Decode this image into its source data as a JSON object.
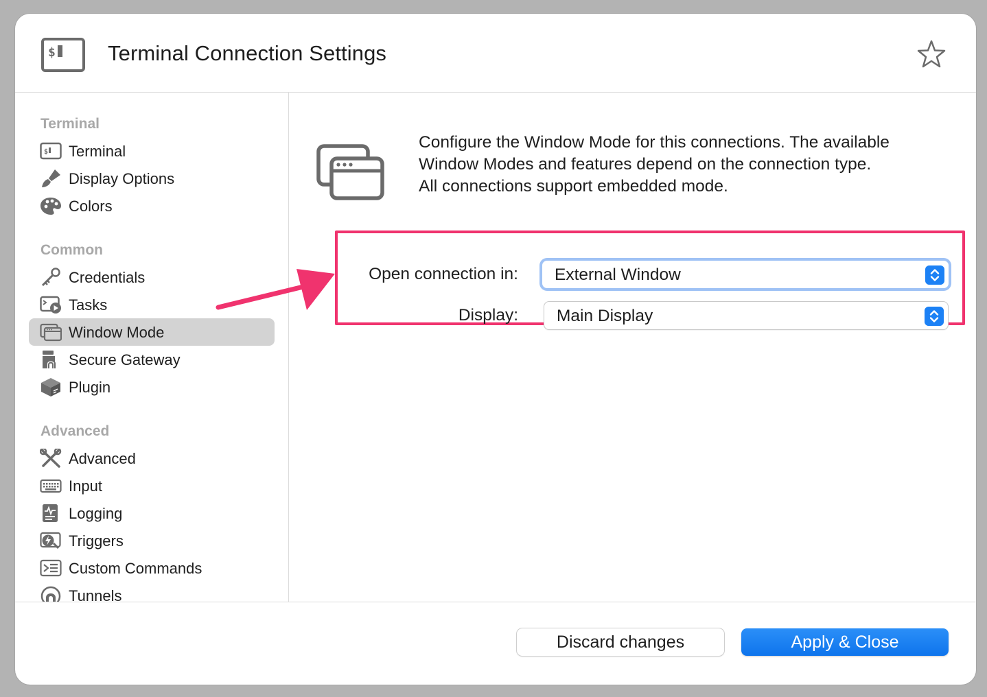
{
  "window": {
    "title": "Terminal Connection Settings"
  },
  "sidebar": {
    "sections": [
      {
        "title": "Terminal",
        "items": [
          {
            "label": "Terminal",
            "icon": "terminal-icon"
          },
          {
            "label": "Display Options",
            "icon": "paintbrush-icon"
          },
          {
            "label": "Colors",
            "icon": "palette-icon"
          }
        ]
      },
      {
        "title": "Common",
        "items": [
          {
            "label": "Credentials",
            "icon": "key-icon"
          },
          {
            "label": "Tasks",
            "icon": "tasks-icon"
          },
          {
            "label": "Window Mode",
            "icon": "window-mode-icon",
            "selected": true
          },
          {
            "label": "Secure Gateway",
            "icon": "gateway-icon"
          },
          {
            "label": "Plugin",
            "icon": "plugin-cube-icon"
          }
        ]
      },
      {
        "title": "Advanced",
        "items": [
          {
            "label": "Advanced",
            "icon": "tools-icon"
          },
          {
            "label": "Input",
            "icon": "keyboard-icon"
          },
          {
            "label": "Logging",
            "icon": "log-icon"
          },
          {
            "label": "Triggers",
            "icon": "triggers-icon"
          },
          {
            "label": "Custom Commands",
            "icon": "custom-commands-icon"
          },
          {
            "label": "Tunnels",
            "icon": "tunnel-icon"
          }
        ]
      }
    ]
  },
  "main": {
    "description": "Configure the Window Mode for this connections. The available\nWindow Modes and features depend on the connection type.\nAll connections support embedded mode.",
    "fields": {
      "open_in": {
        "label": "Open connection in:",
        "value": "External Window"
      },
      "display": {
        "label": "Display:",
        "value": "Main Display"
      }
    }
  },
  "footer": {
    "discard_label": "Discard changes",
    "apply_label": "Apply & Close"
  },
  "colors": {
    "accent": "#1c81f5",
    "highlight_border": "#f0336e",
    "annotation_arrow": "#f0336e",
    "selected_item": "#d3d3d3"
  }
}
